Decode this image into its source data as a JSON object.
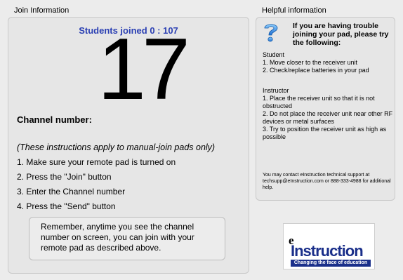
{
  "join": {
    "group_title": "Join Information",
    "students_joined": "Students joined 0 : 107",
    "channel_number": "17",
    "channel_label": "Channel number:",
    "manual_note": "(These instructions apply to manual-join pads only)",
    "steps": [
      "1. Make sure your remote pad is turned on",
      "2. Press the \"Join\" button",
      "3. Enter the Channel number",
      "4. Press the \"Send\" button"
    ],
    "reminder": "Remember, anytime you see the channel number on screen, you can join with your remote pad as described above."
  },
  "help": {
    "group_title": "Helpful information",
    "heading": "If you are having trouble joining your pad, please try the following:",
    "student_section": "Student\n1. Move closer to the receiver unit\n2. Check/replace batteries in your pad",
    "instructor_section": "Instructor\n1. Place the receiver unit so that it is not obstructed\n2. Do not place the receiver unit near other RF devices or metal surfaces\n3. Try to position the receiver unit as high as possible",
    "contact": "You may contact eInstruction technical support at techsupp@eInstruction.com or 888-333-4988 for additional help.",
    "icon": "question-mark-icon"
  },
  "logo": {
    "e": "e",
    "word": "Instruction",
    "tagline": "Changing the face of education",
    "accent": "#1a2f8a"
  }
}
